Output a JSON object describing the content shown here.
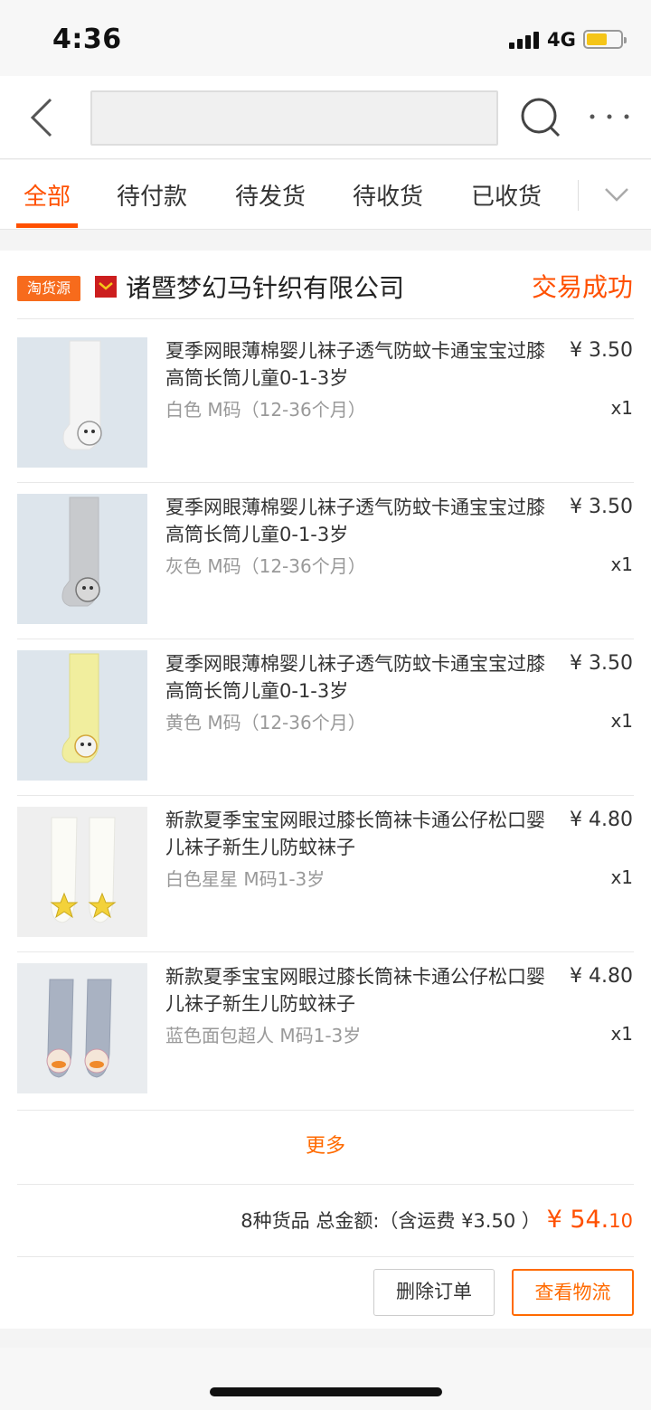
{
  "status_bar": {
    "time": "4:36",
    "network": "4G"
  },
  "search": {
    "placeholder": ""
  },
  "tabs": [
    {
      "label": "全部"
    },
    {
      "label": "待付款"
    },
    {
      "label": "待发货"
    },
    {
      "label": "待收货"
    },
    {
      "label": "已收货"
    }
  ],
  "order": {
    "source_badge": "淘货源",
    "shop_name": "诸暨梦幻马针织有限公司",
    "status": "交易成功",
    "items": [
      {
        "name": "夏季网眼薄棉婴儿袜子透气防蚊卡通宝宝过膝高筒长筒儿童0-1-3岁",
        "price": "¥ 3.50",
        "sku": "白色 M码（12-36个月）",
        "qty": "x1"
      },
      {
        "name": "夏季网眼薄棉婴儿袜子透气防蚊卡通宝宝过膝高筒长筒儿童0-1-3岁",
        "price": "¥ 3.50",
        "sku": "灰色 M码（12-36个月）",
        "qty": "x1"
      },
      {
        "name": "夏季网眼薄棉婴儿袜子透气防蚊卡通宝宝过膝高筒长筒儿童0-1-3岁",
        "price": "¥ 3.50",
        "sku": "黄色 M码（12-36个月）",
        "qty": "x1"
      },
      {
        "name": "新款夏季宝宝网眼过膝长筒袜卡通公仔松口婴儿袜子新生儿防蚊袜子",
        "price": "¥ 4.80",
        "sku": "白色星星 M码1-3岁",
        "qty": "x1"
      },
      {
        "name": "新款夏季宝宝网眼过膝长筒袜卡通公仔松口婴儿袜子新生儿防蚊袜子",
        "price": "¥ 4.80",
        "sku": "蓝色面包超人 M码1-3岁",
        "qty": "x1"
      }
    ],
    "more_label": "更多",
    "summary_text": "8种货品 总金额:（含运费 ¥3.50 ）",
    "total_int": "¥ 54.",
    "total_dec": "10",
    "delete_label": "删除订单",
    "logistics_label": "查看物流"
  },
  "colors": {
    "accent": "#ff5000",
    "badge": "#f76b1c"
  }
}
